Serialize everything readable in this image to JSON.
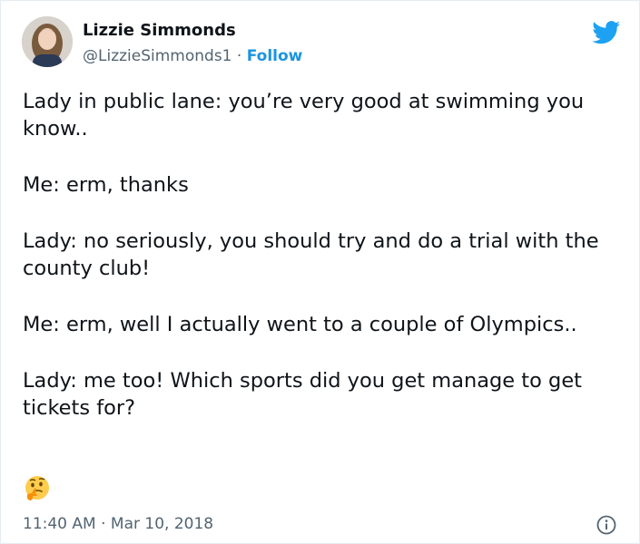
{
  "author": {
    "name": "Lizzie Simmonds",
    "handle": "@LizzieSimmonds1",
    "separator": " · ",
    "follow_label": "Follow",
    "avatar_icon": "profile-photo"
  },
  "brand": {
    "icon": "twitter-bird-icon",
    "color": "#1da1f2",
    "link_color": "#1b95e0"
  },
  "tweet": {
    "paragraphs": [
      "Lady in public lane: you’re very good at swimming you know..",
      "Me: erm, thanks",
      "Lady: no seriously, you should try and do a trial with the county club!",
      "Me: erm, well I actually went to a couple of Olympics..",
      "Lady: me too! Which sports did you get manage to get tickets for?"
    ],
    "emoji": "thinking-face",
    "timestamp": "11:40 AM · Mar 10, 2018"
  },
  "footer": {
    "info_icon": "info-icon"
  }
}
